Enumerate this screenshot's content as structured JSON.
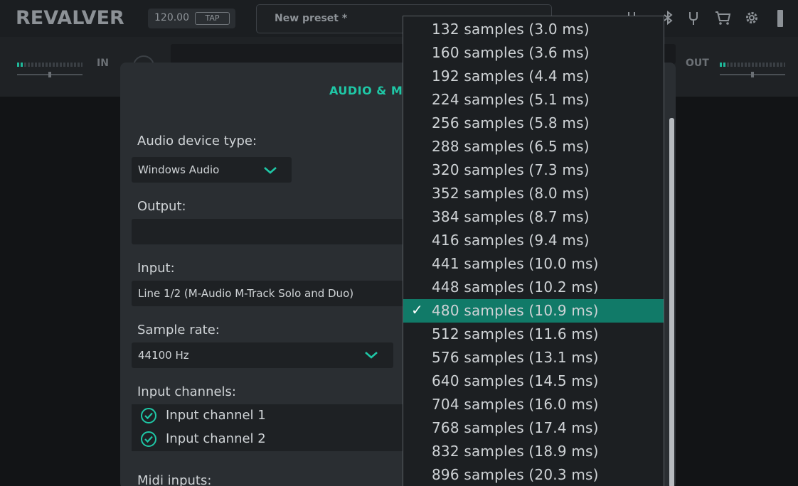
{
  "app": {
    "logo": "REVALVER"
  },
  "topbar": {
    "bpm": "120.00",
    "tap_label": "TAP",
    "preset_name": "New preset *",
    "icons": [
      "tuner-fork-icon",
      "cart-icon",
      "gear-icon",
      "bluetooth-icon",
      "sliders-icon"
    ]
  },
  "io": {
    "in_label": "IN",
    "out_label": "OUT"
  },
  "dialog": {
    "title": "AUDIO & MIDI",
    "device_type": {
      "label": "Audio device type:",
      "value": "Windows Audio"
    },
    "output": {
      "label": "Output:",
      "value": ""
    },
    "input": {
      "label": "Input:",
      "value": "Line 1/2 (M-Audio M-Track Solo and Duo)"
    },
    "sample_rate": {
      "label": "Sample rate:",
      "value": "44100 Hz"
    },
    "input_channels": {
      "label": "Input channels:",
      "items": [
        "Input channel 1",
        "Input channel 2"
      ]
    },
    "midi_inputs": {
      "label": "Midi inputs:"
    }
  },
  "buffer_dropdown": {
    "selected_index": 12,
    "options": [
      "132 samples (3.0 ms)",
      "160 samples (3.6 ms)",
      "192 samples (4.4 ms)",
      "224 samples (5.1 ms)",
      "256 samples (5.8 ms)",
      "288 samples (6.5 ms)",
      "320 samples (7.3 ms)",
      "352 samples (8.0 ms)",
      "384 samples (8.7 ms)",
      "416 samples (9.4 ms)",
      "441 samples (10.0 ms)",
      "448 samples (10.2 ms)",
      "480 samples (10.9 ms)",
      "512 samples (11.6 ms)",
      "576 samples (13.1 ms)",
      "640 samples (14.5 ms)",
      "704 samples (16.0 ms)",
      "768 samples (17.4 ms)",
      "832 samples (18.9 ms)",
      "896 samples (20.3 ms)"
    ],
    "check_glyph": "✓"
  },
  "colors": {
    "accent": "#1fc7a6",
    "selected_row": "#117a68",
    "background": "#121416",
    "panel": "#2a2e32"
  }
}
